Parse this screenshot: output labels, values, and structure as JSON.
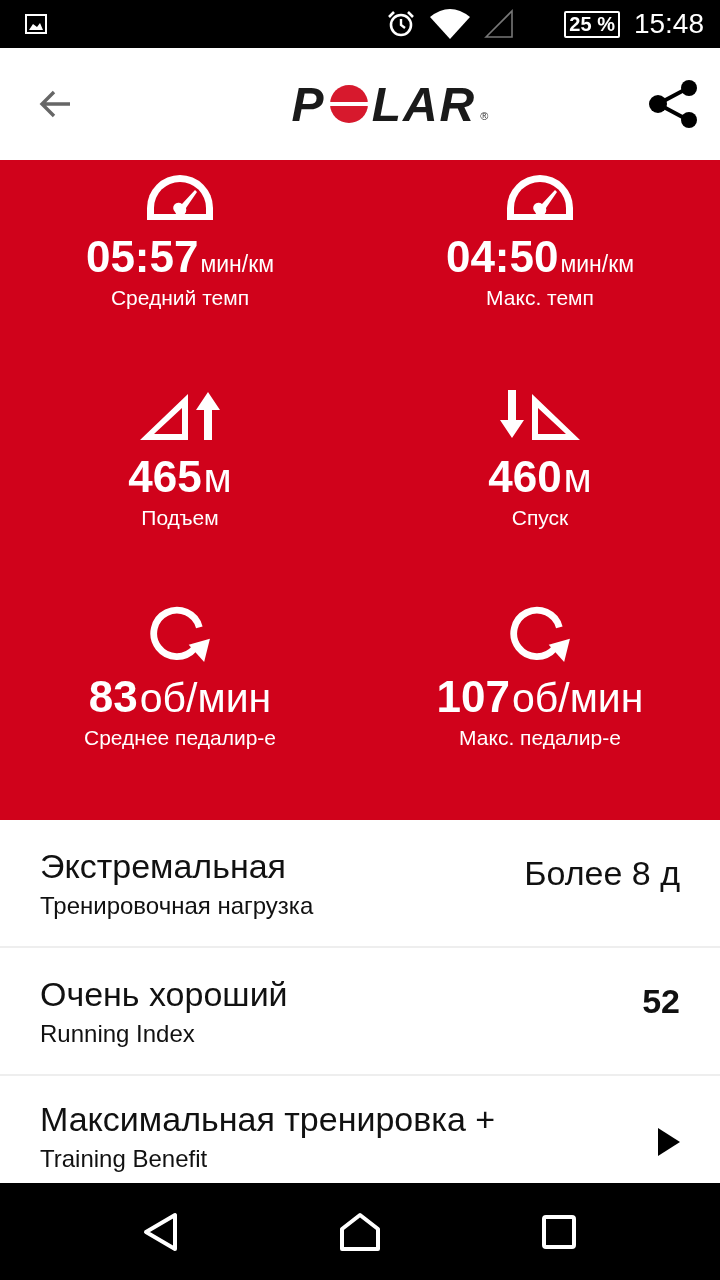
{
  "status_bar": {
    "battery": "25 %",
    "time": "15:48"
  },
  "header": {
    "logo": {
      "lead": "P",
      "tail": "LAR",
      "mark": "®"
    }
  },
  "stats": [
    {
      "kind": "speed",
      "value": "05:57",
      "unit": "мин/км",
      "label": "Средний темп"
    },
    {
      "kind": "speed",
      "value": "04:50",
      "unit": "мин/км",
      "label": "Макс. темп"
    },
    {
      "kind": "ascent",
      "value": "465",
      "unit": "м",
      "label": "Подъем"
    },
    {
      "kind": "descent",
      "value": "460",
      "unit": "м",
      "label": "Спуск"
    },
    {
      "kind": "cadence",
      "value": "83",
      "unit": "об/мин",
      "label": "Среднее педалир-е"
    },
    {
      "kind": "cadence",
      "value": "107",
      "unit": "об/мин",
      "label": "Макс. педалир-е"
    }
  ],
  "items": [
    {
      "kind": "text",
      "title": "Экстремальная",
      "subtitle": "Тренировочная нагрузка",
      "value": "Более 8 д"
    },
    {
      "kind": "number",
      "title": "Очень хороший",
      "subtitle": "Running Index",
      "value": "52"
    },
    {
      "kind": "link",
      "title": "Максимальная тренировка +",
      "subtitle": "Training Benefit"
    }
  ]
}
